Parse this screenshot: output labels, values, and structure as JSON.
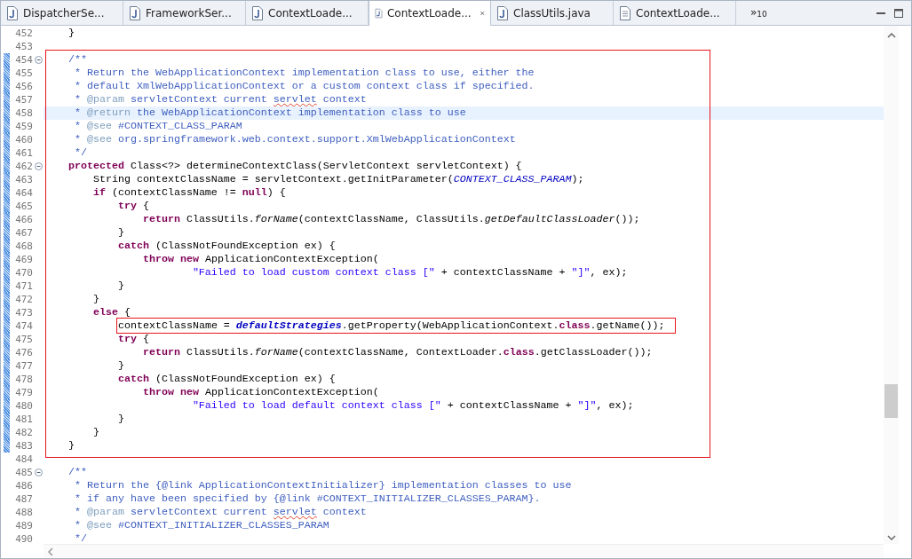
{
  "tabs": [
    {
      "label": "DispatcherSe...",
      "kind": "java",
      "selected": false
    },
    {
      "label": "FrameworkSer...",
      "kind": "java",
      "selected": false
    },
    {
      "label": "ContextLoade...",
      "kind": "java",
      "selected": false
    },
    {
      "label": "ContextLoade...",
      "kind": "java",
      "selected": true
    },
    {
      "label": "ClassUtils.java",
      "kind": "java",
      "selected": false
    },
    {
      "label": "ContextLoade...",
      "kind": "file",
      "selected": false
    }
  ],
  "overflow": {
    "symbol": "»",
    "count": "10"
  },
  "lines": [
    {
      "number": "452",
      "tokens": [
        {
          "kind": "plain",
          "text": "    }"
        }
      ]
    },
    {
      "number": "453"
    },
    {
      "number": "454",
      "fold": true,
      "changed": true,
      "box_start": true,
      "tokens": [
        {
          "kind": "comment",
          "text": "    /**"
        }
      ]
    },
    {
      "number": "455",
      "changed": true,
      "tokens": [
        {
          "kind": "comment",
          "text": "     * Return the WebApplicationContext implementation class to use, either the"
        }
      ]
    },
    {
      "number": "456",
      "changed": true,
      "tokens": [
        {
          "kind": "comment",
          "text": "     * default XmlWebApplicationContext or a custom context class if specified."
        }
      ]
    },
    {
      "number": "457",
      "changed": true,
      "tokens": [
        {
          "kind": "comment",
          "text": "     * "
        },
        {
          "kind": "tag",
          "text": "@param"
        },
        {
          "kind": "comment",
          "text": " servletContext current "
        },
        {
          "kind": "misspelled",
          "text": "servlet"
        },
        {
          "kind": "comment",
          "text": " context"
        }
      ]
    },
    {
      "number": "458",
      "changed": true,
      "current": true,
      "tokens": [
        {
          "kind": "comment",
          "text": "     * "
        },
        {
          "kind": "tag",
          "text": "@return"
        },
        {
          "kind": "comment",
          "text": " the WebApplicationContext implementation class to use"
        }
      ]
    },
    {
      "number": "459",
      "changed": true,
      "tokens": [
        {
          "kind": "comment",
          "text": "     * "
        },
        {
          "kind": "tag",
          "text": "@see"
        },
        {
          "kind": "comment",
          "text": " #CONTEXT_CLASS_PARAM"
        }
      ]
    },
    {
      "number": "460",
      "changed": true,
      "tokens": [
        {
          "kind": "comment",
          "text": "     * "
        },
        {
          "kind": "tag",
          "text": "@see"
        },
        {
          "kind": "comment",
          "text": " org.springframework.web.context.support.XmlWebApplicationContext"
        }
      ]
    },
    {
      "number": "461",
      "changed": true,
      "tokens": [
        {
          "kind": "comment",
          "text": "     */"
        }
      ]
    },
    {
      "number": "462",
      "fold": true,
      "changed": true,
      "tokens": [
        {
          "kind": "keyword",
          "text": "    protected"
        },
        {
          "kind": "plain",
          "text": " Class<?> determineContextClass(ServletContext servletContext) {"
        }
      ]
    },
    {
      "number": "463",
      "changed": true,
      "tokens": [
        {
          "kind": "plain",
          "text": "        String contextClassName = servletContext.getInitParameter("
        },
        {
          "kind": "constant",
          "text": "CONTEXT_CLASS_PARAM"
        },
        {
          "kind": "plain",
          "text": ");"
        }
      ]
    },
    {
      "number": "464",
      "changed": true,
      "tokens": [
        {
          "kind": "keyword",
          "text": "        if"
        },
        {
          "kind": "plain",
          "text": " (contextClassName != "
        },
        {
          "kind": "keyword",
          "text": "null"
        },
        {
          "kind": "plain",
          "text": ") {"
        }
      ]
    },
    {
      "number": "465",
      "changed": true,
      "tokens": [
        {
          "kind": "keyword",
          "text": "            try"
        },
        {
          "kind": "plain",
          "text": " {"
        }
      ]
    },
    {
      "number": "466",
      "changed": true,
      "tokens": [
        {
          "kind": "keyword",
          "text": "                return"
        },
        {
          "kind": "plain",
          "text": " ClassUtils."
        },
        {
          "kind": "static-method",
          "text": "forName"
        },
        {
          "kind": "plain",
          "text": "(contextClassName, ClassUtils."
        },
        {
          "kind": "static-method",
          "text": "getDefaultClassLoader"
        },
        {
          "kind": "plain",
          "text": "());"
        }
      ]
    },
    {
      "number": "467",
      "changed": true,
      "tokens": [
        {
          "kind": "plain",
          "text": "            }"
        }
      ]
    },
    {
      "number": "468",
      "changed": true,
      "tokens": [
        {
          "kind": "keyword",
          "text": "            catch"
        },
        {
          "kind": "plain",
          "text": " (ClassNotFoundException ex) {"
        }
      ]
    },
    {
      "number": "469",
      "changed": true,
      "tokens": [
        {
          "kind": "keyword",
          "text": "                throw"
        },
        {
          "kind": "keyword",
          "text": " new"
        },
        {
          "kind": "plain",
          "text": " ApplicationContextException("
        }
      ]
    },
    {
      "number": "470",
      "changed": true,
      "tokens": [
        {
          "kind": "string",
          "text": "                        \"Failed to load custom context class [\""
        },
        {
          "kind": "plain",
          "text": " + contextClassName + "
        },
        {
          "kind": "string",
          "text": "\"]\""
        },
        {
          "kind": "plain",
          "text": ", ex);"
        }
      ]
    },
    {
      "number": "471",
      "changed": true,
      "tokens": [
        {
          "kind": "plain",
          "text": "            }"
        }
      ]
    },
    {
      "number": "472",
      "changed": true,
      "tokens": [
        {
          "kind": "plain",
          "text": "        }"
        }
      ]
    },
    {
      "number": "473",
      "changed": true,
      "tokens": [
        {
          "kind": "keyword",
          "text": "        else"
        },
        {
          "kind": "plain",
          "text": " {"
        }
      ]
    },
    {
      "number": "474",
      "changed": true,
      "inner_box": true,
      "tokens": [
        {
          "kind": "plain",
          "text": "            contextClassName = "
        },
        {
          "kind": "field",
          "text": "defaultStrategies"
        },
        {
          "kind": "plain",
          "text": ".getProperty(WebApplicationContext."
        },
        {
          "kind": "keyword",
          "text": "class"
        },
        {
          "kind": "plain",
          "text": ".getName());"
        }
      ]
    },
    {
      "number": "475",
      "changed": true,
      "tokens": [
        {
          "kind": "keyword",
          "text": "            try"
        },
        {
          "kind": "plain",
          "text": " {"
        }
      ]
    },
    {
      "number": "476",
      "changed": true,
      "tokens": [
        {
          "kind": "keyword",
          "text": "                return"
        },
        {
          "kind": "plain",
          "text": " ClassUtils."
        },
        {
          "kind": "static-method",
          "text": "forName"
        },
        {
          "kind": "plain",
          "text": "(contextClassName, ContextLoader."
        },
        {
          "kind": "keyword",
          "text": "class"
        },
        {
          "kind": "plain",
          "text": ".getClassLoader());"
        }
      ]
    },
    {
      "number": "477",
      "changed": true,
      "tokens": [
        {
          "kind": "plain",
          "text": "            }"
        }
      ]
    },
    {
      "number": "478",
      "changed": true,
      "tokens": [
        {
          "kind": "keyword",
          "text": "            catch"
        },
        {
          "kind": "plain",
          "text": " (ClassNotFoundException ex) {"
        }
      ]
    },
    {
      "number": "479",
      "changed": true,
      "tokens": [
        {
          "kind": "keyword",
          "text": "                throw"
        },
        {
          "kind": "keyword",
          "text": " new"
        },
        {
          "kind": "plain",
          "text": " ApplicationContextException("
        }
      ]
    },
    {
      "number": "480",
      "changed": true,
      "tokens": [
        {
          "kind": "string",
          "text": "                        \"Failed to load default context class [\""
        },
        {
          "kind": "plain",
          "text": " + contextClassName + "
        },
        {
          "kind": "string",
          "text": "\"]\""
        },
        {
          "kind": "plain",
          "text": ", ex);"
        }
      ]
    },
    {
      "number": "481",
      "changed": true,
      "tokens": [
        {
          "kind": "plain",
          "text": "            }"
        }
      ]
    },
    {
      "number": "482",
      "changed": true,
      "tokens": [
        {
          "kind": "plain",
          "text": "        }"
        }
      ]
    },
    {
      "number": "483",
      "changed": true,
      "box_end": true,
      "tokens": [
        {
          "kind": "plain",
          "text": "    }"
        }
      ]
    },
    {
      "number": "484"
    },
    {
      "number": "485",
      "fold": true,
      "tokens": [
        {
          "kind": "comment",
          "text": "    /**"
        }
      ]
    },
    {
      "number": "486",
      "tokens": [
        {
          "kind": "comment",
          "text": "     * Return the {@link ApplicationContextInitializer} implementation classes to use"
        }
      ]
    },
    {
      "number": "487",
      "tokens": [
        {
          "kind": "comment",
          "text": "     * if any have been specified by {@link #CONTEXT_INITIALIZER_CLASSES_PARAM}."
        }
      ]
    },
    {
      "number": "488",
      "tokens": [
        {
          "kind": "comment",
          "text": "     * "
        },
        {
          "kind": "tag",
          "text": "@param"
        },
        {
          "kind": "comment",
          "text": " servletContext current "
        },
        {
          "kind": "misspelled",
          "text": "servlet"
        },
        {
          "kind": "comment",
          "text": " context"
        }
      ]
    },
    {
      "number": "489",
      "tokens": [
        {
          "kind": "comment",
          "text": "     * "
        },
        {
          "kind": "tag",
          "text": "@see"
        },
        {
          "kind": "comment",
          "text": " #CONTEXT_INITIALIZER_CLASSES_PARAM"
        }
      ]
    },
    {
      "number": "490",
      "tokens": [
        {
          "kind": "comment",
          "text": "     */"
        }
      ]
    }
  ]
}
